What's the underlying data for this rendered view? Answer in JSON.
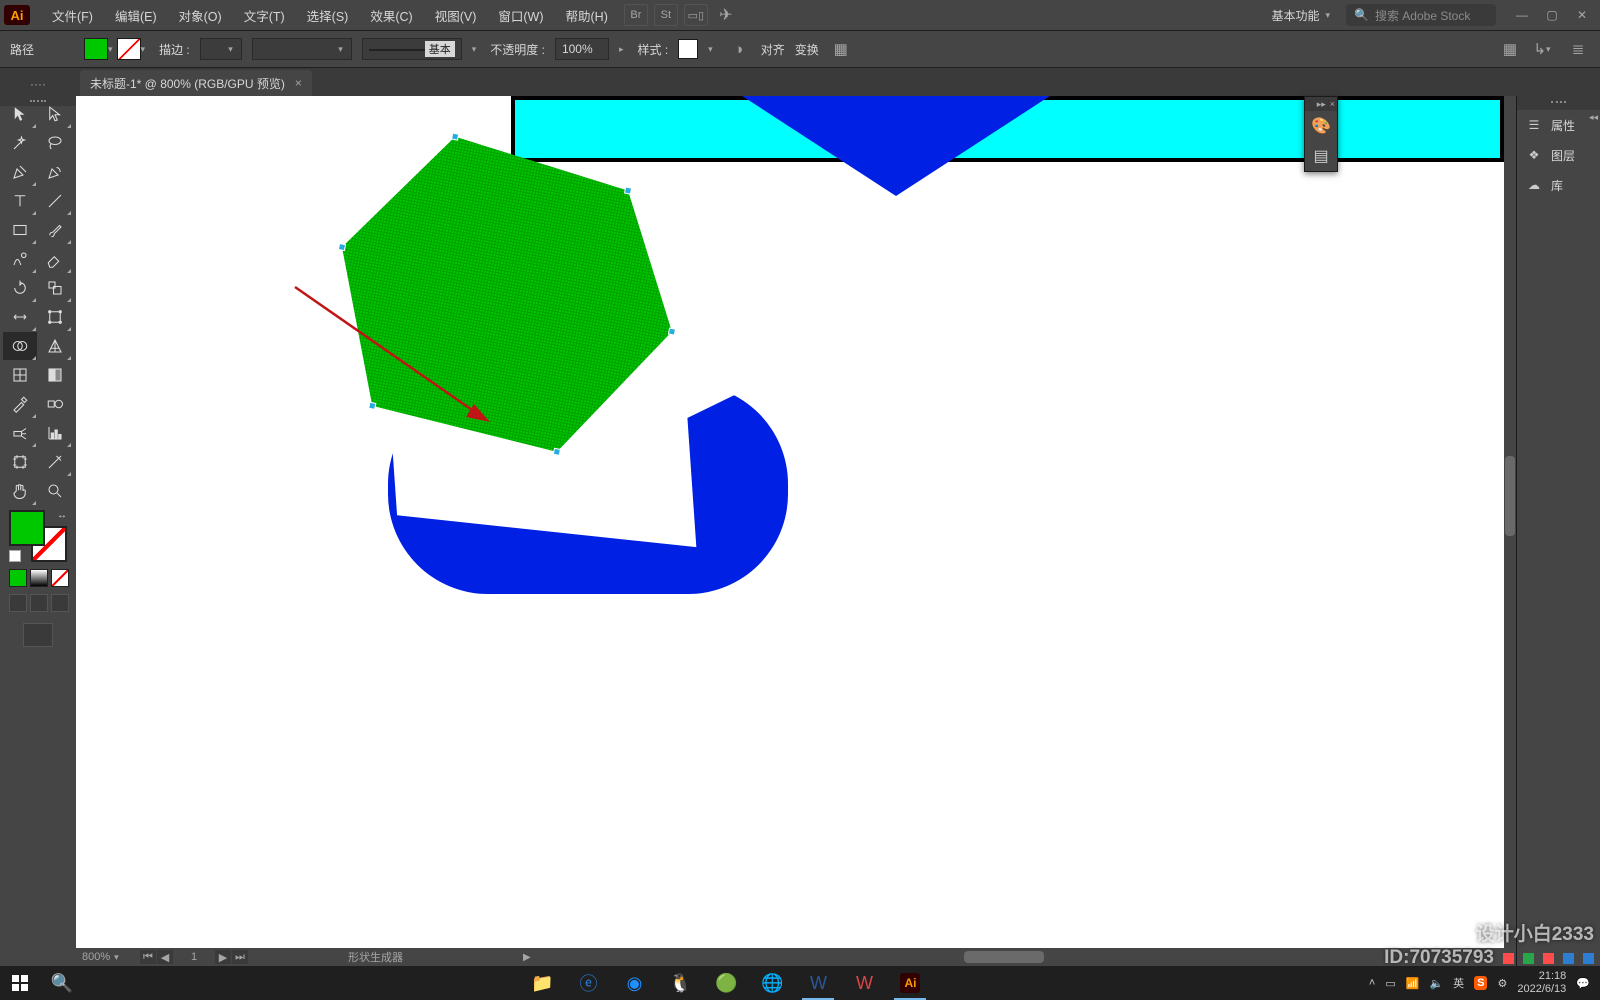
{
  "app": {
    "logo": "Ai"
  },
  "menu": {
    "items": [
      "文件(F)",
      "编辑(E)",
      "对象(O)",
      "文字(T)",
      "选择(S)",
      "效果(C)",
      "视图(V)",
      "窗口(W)",
      "帮助(H)"
    ]
  },
  "topbar": {
    "workspace_label": "基本功能",
    "search_placeholder": "搜索 Adobe Stock",
    "bridge": "Br",
    "stock": "St"
  },
  "ctrlbar": {
    "mode_label": "路径",
    "stroke_label": "描边 :",
    "stroke_weight": "",
    "profile_label": "基本",
    "opacity_label": "不透明度 :",
    "opacity_value": "100%",
    "style_label": "样式 :",
    "align_label": "对齐",
    "transform_label": "变换"
  },
  "doc": {
    "tab_title": "未标题-1* @ 800% (RGB/GPU 预览)"
  },
  "statusbar": {
    "zoom": "800%",
    "artboard_index": "1",
    "tool_name": "形状生成器"
  },
  "right_panel": {
    "items": [
      {
        "icon": "sliders",
        "label": "属性"
      },
      {
        "icon": "layers",
        "label": "图层"
      },
      {
        "icon": "cc",
        "label": "库"
      }
    ]
  },
  "taskbar": {
    "time": "21:18",
    "date": "2022/6/13",
    "ime": "英"
  },
  "watermark": {
    "line1": "设计小白2333",
    "line2_prefix": "ID:70735793"
  }
}
